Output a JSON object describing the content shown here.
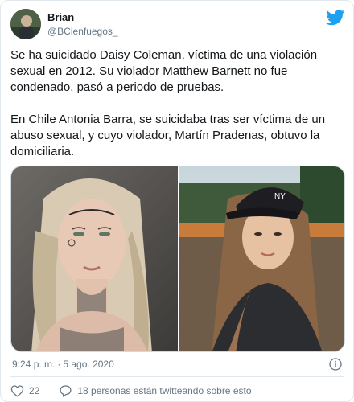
{
  "author": {
    "display_name": "Brian",
    "handle": "@BCienfuegos_"
  },
  "tweet": {
    "text": "Se ha suicidado Daisy Coleman, víctima de una violación sexual en 2012. Su violador Matthew Barnett no fue condenado, pasó a periodo de pruebas.\n\nEn Chile Antonia Barra, se suicidaba tras ser víctima de un abuso sexual, y cuyo violador, Martín Pradenas, obtuvo la domiciliaria.",
    "time": "9:24 p. m.",
    "separator": "·",
    "date": "5 ago. 2020"
  },
  "actions": {
    "likes": "22",
    "talking": "18 personas están twitteando sobre esto"
  },
  "icons": {
    "brand": "twitter-bird-icon",
    "info": "info-icon",
    "like": "heart-icon",
    "comment": "speech-bubble-icon"
  },
  "colors": {
    "twitter_blue": "#1da1f2",
    "secondary_text": "#657786",
    "primary_text": "#14171a",
    "border": "#e1e8ed"
  }
}
